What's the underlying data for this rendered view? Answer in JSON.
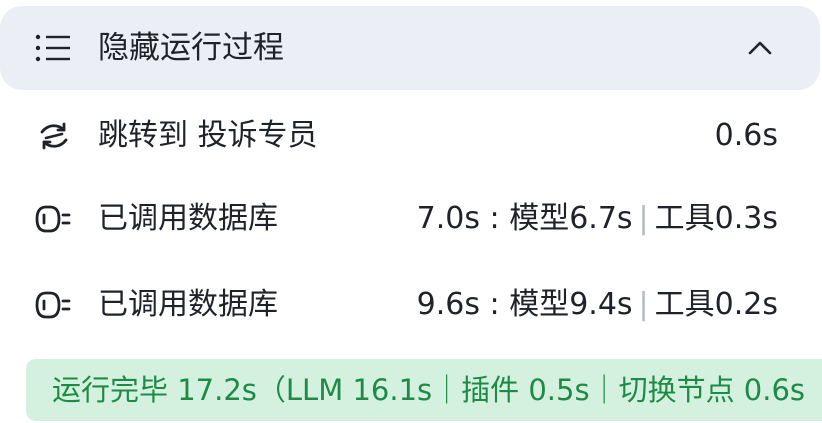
{
  "header": {
    "title": "隐藏运行过程",
    "list_icon": "list-icon",
    "toggle_icon": "chevron-up-icon"
  },
  "rows": [
    {
      "icon": "jump-icon",
      "label": "跳转到 投诉专员",
      "time": "0.6s"
    },
    {
      "icon": "database-icon",
      "label": "已调用数据库",
      "time_total": "7.0s",
      "time_model": "模型6.7s",
      "time_tool": "工具0.3s"
    },
    {
      "icon": "database-icon",
      "label": "已调用数据库",
      "time_total": "9.6s",
      "time_model": "模型9.4s",
      "time_tool": "工具0.2s"
    }
  ],
  "summary": {
    "text": "运行完毕 17.2s（LLM 16.1s｜插件 0.5s｜切换节点 0.6s"
  },
  "colors": {
    "header_bg": "#ebeef5",
    "summary_bg": "#d4f1df",
    "summary_text": "#1f8a47",
    "text": "#1f2329"
  }
}
